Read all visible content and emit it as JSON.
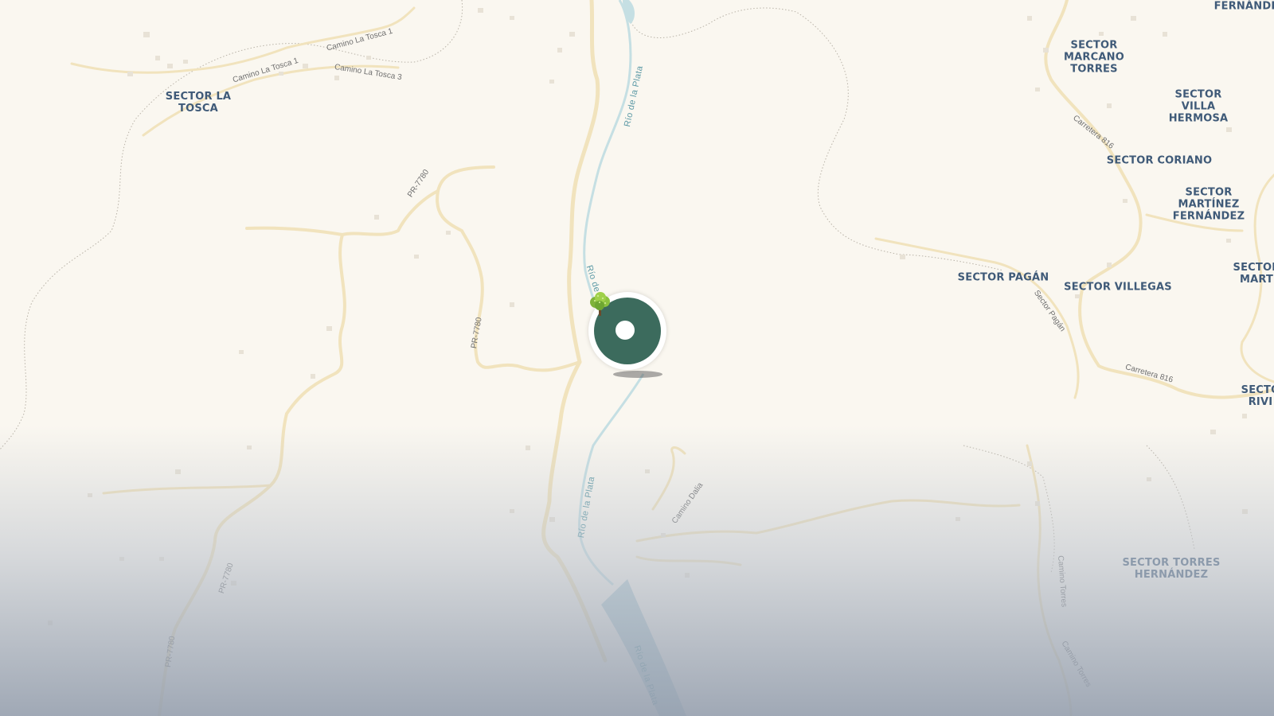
{
  "map": {
    "area_labels": {
      "sector_la_tosca": "SECTOR LA\nTOSCA",
      "sector_marcano_torres": "SECTOR\nMARCANO\nTORRES",
      "sector_villa_hermosa": "SECTOR VILLA\nHERMOSA",
      "sector_coriano": "SECTOR CORIANO",
      "sector_martinez_fernandez": "SECTOR\nMARTÍNEZ\nFERNÁNDEZ",
      "sector_pagan": "SECTOR PAGÁN",
      "sector_villegas": "SECTOR VILLEGAS",
      "sector_torres_hernandez": "SECTOR TORRES\nHERNÁNDEZ",
      "fernandez_partial": "FERNÁNDE",
      "sector_mart_partial": "SECTOR\nMART",
      "secto_rivi_partial": "SECTO\nRIVI"
    },
    "road_labels": {
      "camino_la_tosca_1_a": "Camino La Tosca 1",
      "camino_la_tosca_1_b": "Camino La Tosca 1",
      "camino_la_tosca_3": "Camino La Tosca 3",
      "pr_7780_top": "PR-7780",
      "pr_7780_mid": "PR-7780",
      "pr_7780_low": "PR-7780",
      "pr_7780_bottom": "PR-7780",
      "carretera_816_top": "Carretera 816",
      "carretera_816_mid": "Carretera 816",
      "sector_pagan_road": "Sector Pagán",
      "camino_dalia": "Camino Dalia",
      "camino_torres_a": "Camino Torres",
      "camino_torres_b": "Camino Torres"
    },
    "river_labels": {
      "rio_top": "Río de la Plata",
      "rio_mid": "Río de la",
      "rio_low": "Río de la Plata",
      "rio_bottom": "Río de la Plata"
    },
    "marker": {
      "icon": "tree-icon",
      "color": "#3c6b5d"
    },
    "colors": {
      "land": "#faf7f0",
      "river": "#c5dfe3",
      "road": "#f3e6c4",
      "label": "#3f5a78"
    }
  }
}
